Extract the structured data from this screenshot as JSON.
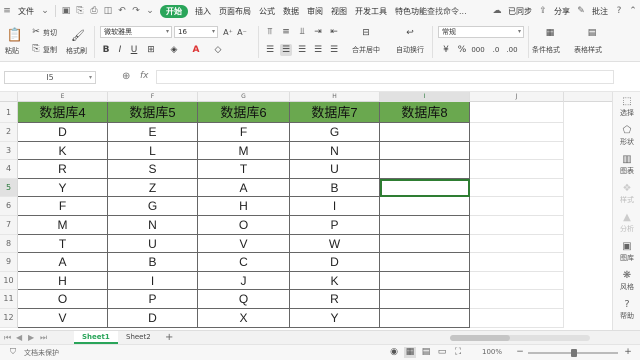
{
  "menu": {
    "file": "文件",
    "tabs": [
      "开始",
      "插入",
      "页面布局",
      "公式",
      "数据",
      "审阅",
      "视图",
      "开发工具",
      "特色功能"
    ],
    "active_tab": "开始",
    "search": "查找命令...",
    "cloud": "已同步",
    "share": "分享",
    "comment": "批注"
  },
  "ribbon": {
    "paste": "粘贴",
    "cut": "剪切",
    "copy": "复制",
    "format_painter": "格式刷",
    "font_name": "微软雅黑",
    "font_size": "16",
    "bold": "B",
    "italic": "I",
    "underline": "U",
    "merge_center": "合并居中",
    "auto_wrap": "自动换行",
    "number_format": "常规",
    "cond_format": "条件格式",
    "table_style": "表格样式"
  },
  "formula_bar": {
    "name_box": "I5",
    "fx": "fx",
    "content": ""
  },
  "grid": {
    "columns": [
      "E",
      "F",
      "G",
      "H",
      "I",
      "J"
    ],
    "active_column": "I",
    "rows": [
      "1",
      "2",
      "3",
      "4",
      "5",
      "6",
      "7",
      "8",
      "9",
      "10",
      "11",
      "12"
    ],
    "active_row": "5",
    "headers": [
      "数据库4",
      "数据库5",
      "数据库6",
      "数据库7",
      "数据库8"
    ],
    "data": [
      [
        "D",
        "E",
        "F",
        "G",
        ""
      ],
      [
        "K",
        "L",
        "M",
        "N",
        ""
      ],
      [
        "R",
        "S",
        "T",
        "U",
        ""
      ],
      [
        "Y",
        "Z",
        "A",
        "B",
        ""
      ],
      [
        "F",
        "G",
        "H",
        "I",
        ""
      ],
      [
        "M",
        "N",
        "O",
        "P",
        ""
      ],
      [
        "T",
        "U",
        "V",
        "W",
        ""
      ],
      [
        "A",
        "B",
        "C",
        "D",
        ""
      ],
      [
        "H",
        "I",
        "J",
        "K",
        ""
      ],
      [
        "O",
        "P",
        "Q",
        "R",
        ""
      ],
      [
        "V",
        "D",
        "X",
        "Y",
        ""
      ]
    ],
    "selected_cell": "I5",
    "header_color": "#6aa84f"
  },
  "rail": [
    "选择",
    "形状",
    "图表",
    "样式",
    "分析",
    "图库",
    "风格",
    "帮助"
  ],
  "sheets": {
    "tabs": [
      "Sheet1",
      "Sheet2"
    ],
    "active": "Sheet1",
    "add": "+"
  },
  "status": {
    "protection": "文档未保护",
    "zoom": "100%"
  },
  "colors": {
    "accent": "#2aa55a",
    "selection": "#2e7d32"
  }
}
